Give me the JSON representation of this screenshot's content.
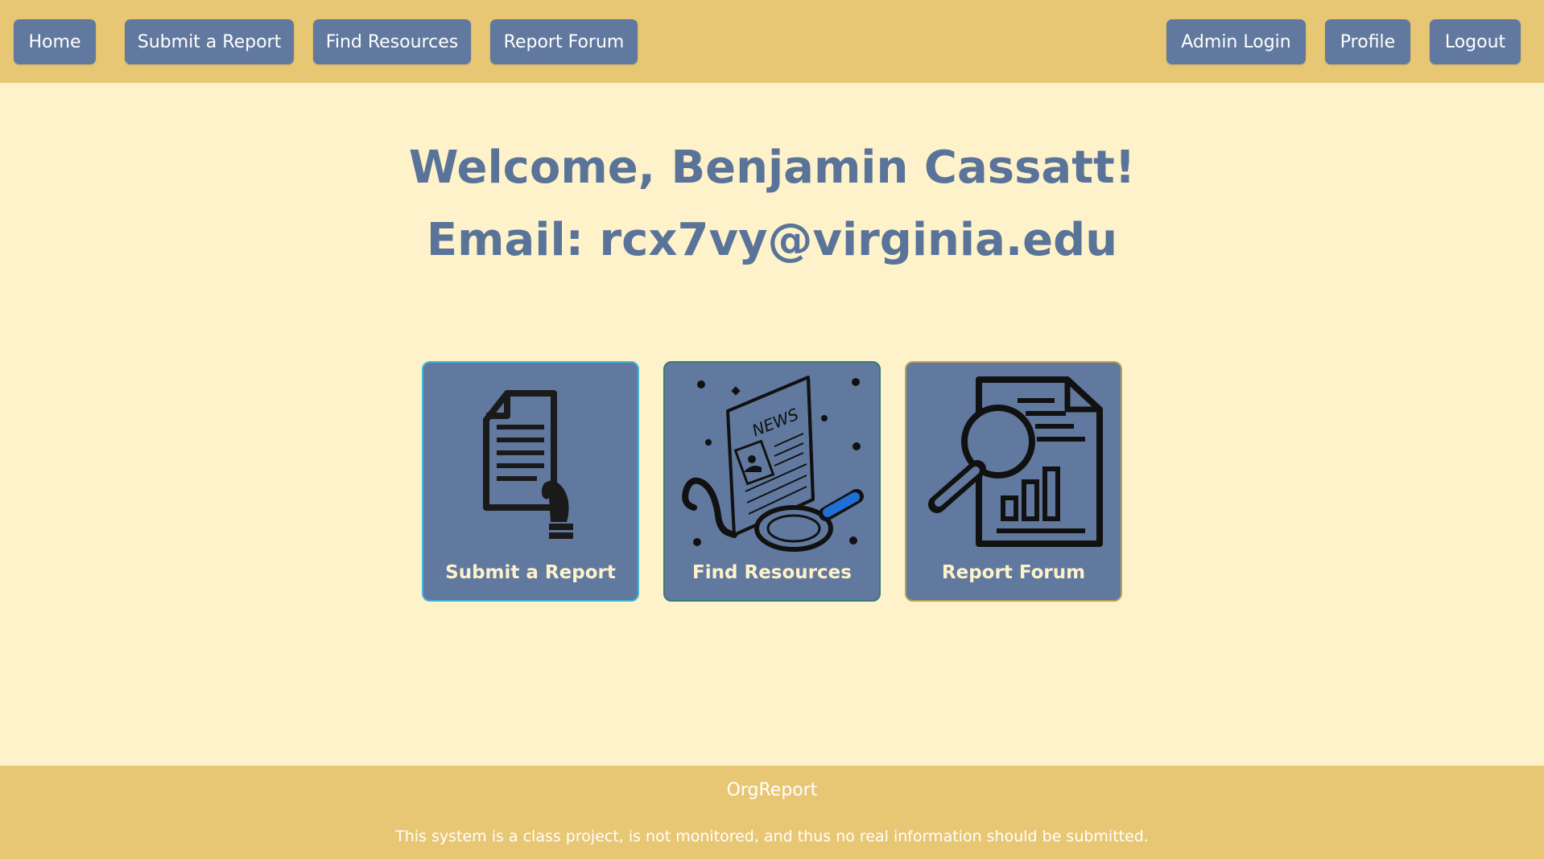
{
  "nav": {
    "home": "Home",
    "submit_report": "Submit a Report",
    "find_resources": "Find Resources",
    "report_forum": "Report Forum",
    "admin_login": "Admin Login",
    "profile": "Profile",
    "logout": "Logout"
  },
  "welcome": {
    "greeting": "Welcome, Benjamin Cassatt!",
    "email": "Email: rcx7vy@virginia.edu"
  },
  "cards": [
    {
      "label": "Submit a Report",
      "icon": "document-hand-icon"
    },
    {
      "label": "Find Resources",
      "icon": "news-magnifier-icon"
    },
    {
      "label": "Report Forum",
      "icon": "report-analysis-icon"
    }
  ],
  "card_image_text": "NEWS",
  "footer": {
    "brand": "OrgReport",
    "note": "This system is a class project, is not monitored, and thus no real information should be submitted."
  },
  "colors": {
    "header_bg": "#e8c774",
    "page_bg": "#fef2ca",
    "button_bg": "#61799e",
    "heading_text": "#5a7399",
    "card_label_text": "#fef2ca"
  }
}
